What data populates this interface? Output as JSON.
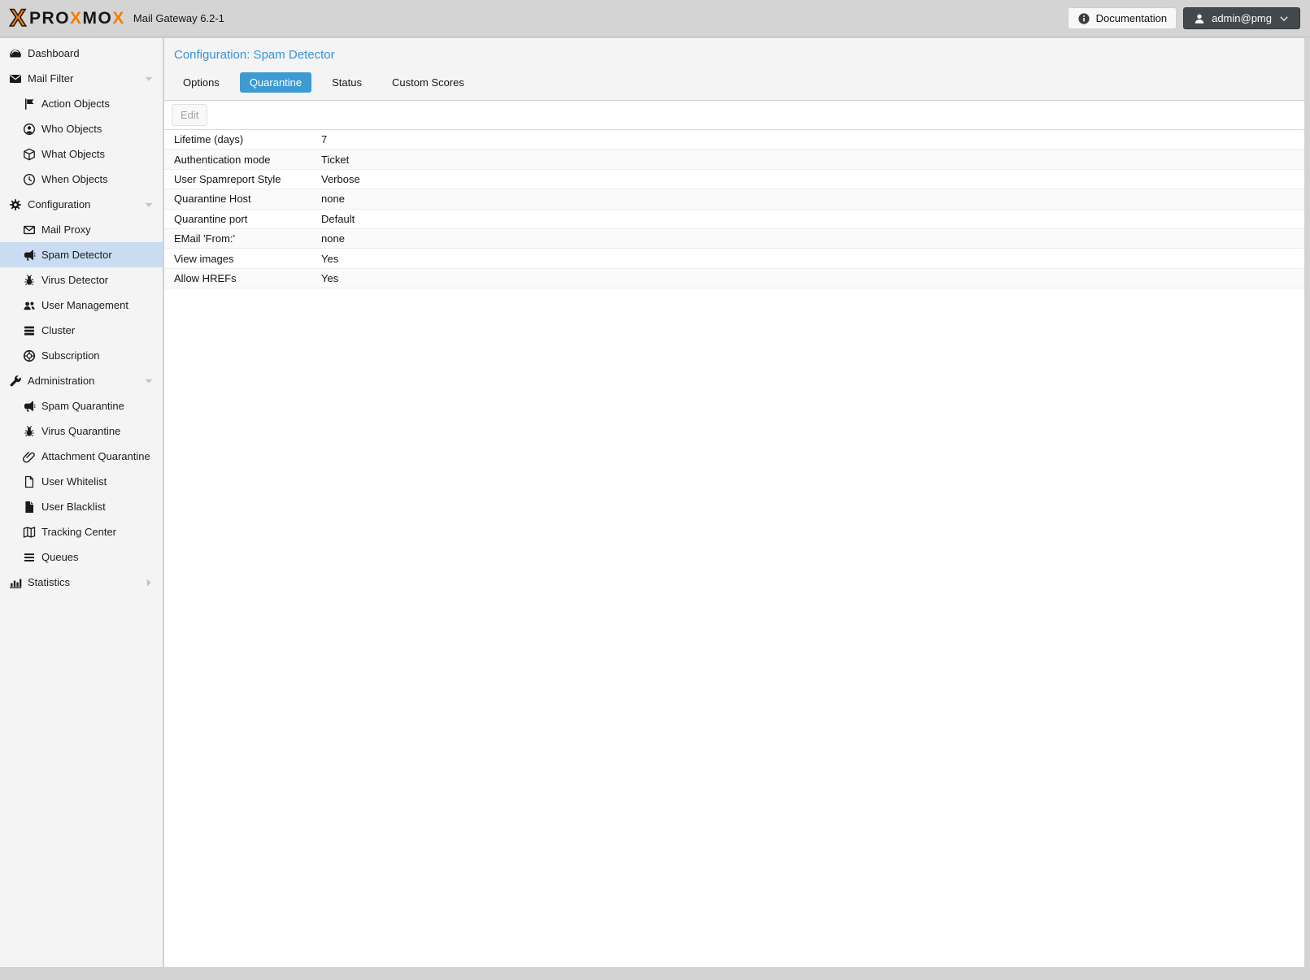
{
  "topbar": {
    "brand": {
      "icon_char": "X",
      "part1": "PRO",
      "part2": "X",
      "part3": "MO",
      "part4": "X"
    },
    "product": "Mail Gateway 6.2-1",
    "documentation_label": "Documentation",
    "user_menu_label": "admin@pmg"
  },
  "sidebar": {
    "items": [
      {
        "label": "Dashboard",
        "icon": "dashboard-icon",
        "level": 0
      },
      {
        "label": "Mail Filter",
        "icon": "envelope-icon",
        "level": 0,
        "expanded": true
      },
      {
        "label": "Action Objects",
        "icon": "flag-icon",
        "level": 1
      },
      {
        "label": "Who Objects",
        "icon": "user-circle-icon",
        "level": 1
      },
      {
        "label": "What Objects",
        "icon": "cube-icon",
        "level": 1
      },
      {
        "label": "When Objects",
        "icon": "clock-icon",
        "level": 1
      },
      {
        "label": "Configuration",
        "icon": "gears-icon",
        "level": 0,
        "expanded": true
      },
      {
        "label": "Mail Proxy",
        "icon": "envelope-outline-icon",
        "level": 1
      },
      {
        "label": "Spam Detector",
        "icon": "bullhorn-icon",
        "level": 1,
        "selected": true
      },
      {
        "label": "Virus Detector",
        "icon": "bug-icon",
        "level": 1
      },
      {
        "label": "User Management",
        "icon": "users-icon",
        "level": 1
      },
      {
        "label": "Cluster",
        "icon": "cluster-icon",
        "level": 1
      },
      {
        "label": "Subscription",
        "icon": "life-ring-icon",
        "level": 1
      },
      {
        "label": "Administration",
        "icon": "wrench-icon",
        "level": 0,
        "expanded": true
      },
      {
        "label": "Spam Quarantine",
        "icon": "bullhorn-icon",
        "level": 1
      },
      {
        "label": "Virus Quarantine",
        "icon": "bug-icon",
        "level": 1
      },
      {
        "label": "Attachment Quarantine",
        "icon": "paperclip-icon",
        "level": 1
      },
      {
        "label": "User Whitelist",
        "icon": "file-outline-icon",
        "level": 1
      },
      {
        "label": "User Blacklist",
        "icon": "file-solid-icon",
        "level": 1
      },
      {
        "label": "Tracking Center",
        "icon": "map-icon",
        "level": 1
      },
      {
        "label": "Queues",
        "icon": "bars-icon",
        "level": 1
      },
      {
        "label": "Statistics",
        "icon": "bar-chart-icon",
        "level": 0,
        "collapsed": true
      }
    ]
  },
  "content": {
    "title": "Configuration: Spam Detector",
    "tabs": [
      {
        "label": "Options",
        "active": false
      },
      {
        "label": "Quarantine",
        "active": true
      },
      {
        "label": "Status",
        "active": false
      },
      {
        "label": "Custom Scores",
        "active": false
      }
    ],
    "toolbar": {
      "edit_label": "Edit"
    },
    "settings": {
      "rows": [
        {
          "label": "Lifetime (days)",
          "value": "7"
        },
        {
          "label": "Authentication mode",
          "value": "Ticket"
        },
        {
          "label": "User Spamreport Style",
          "value": "Verbose"
        },
        {
          "label": "Quarantine Host",
          "value": "none"
        },
        {
          "label": "Quarantine port",
          "value": "Default"
        },
        {
          "label": "EMail 'From:'",
          "value": "none"
        },
        {
          "label": "View images",
          "value": "Yes"
        },
        {
          "label": "Allow HREFs",
          "value": "Yes"
        }
      ]
    }
  },
  "colors": {
    "accent": "#3d9ad3",
    "selection": "#c9dcf1",
    "brand_orange": "#ef7d0a",
    "topbar_bg": "#d4d4d4",
    "sidebar_bg": "#f4f4f4"
  }
}
